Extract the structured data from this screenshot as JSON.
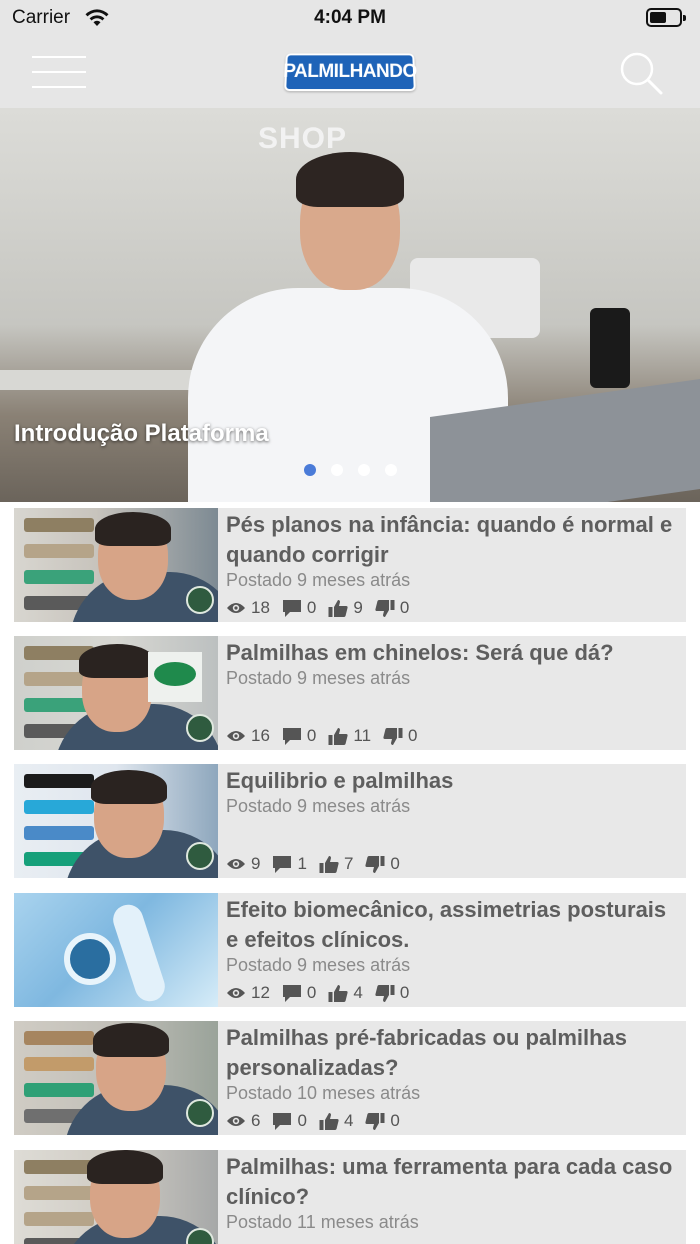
{
  "status_bar": {
    "carrier": "Carrier",
    "time": "4:04 PM",
    "battery_level": 0.55
  },
  "nav": {
    "logo_text": "PALMILHANDO",
    "menu_icon": "hamburger-icon",
    "search_icon": "search-icon"
  },
  "hero": {
    "wall_text": "SHOP",
    "title": "Introdução Plataforma",
    "slides": 4,
    "active_slide": 1
  },
  "videos": [
    {
      "title": "Pés planos na infância: quando é normal e quando corrigir",
      "posted": "Postado 9 meses atrás",
      "views": "18",
      "comments": "0",
      "likes": "9",
      "dislikes": "0"
    },
    {
      "title": "Palmilhas em chinelos: Será que dá?",
      "posted": "Postado 9 meses atrás",
      "views": "16",
      "comments": "0",
      "likes": "11",
      "dislikes": "0"
    },
    {
      "title": "Equilibrio e palmilhas",
      "posted": "Postado 9 meses atrás",
      "views": "9",
      "comments": "1",
      "likes": "7",
      "dislikes": "0"
    },
    {
      "title": "Efeito biomecânico, assimetrias posturais e efeitos clínicos.",
      "posted": "Postado 9 meses atrás",
      "views": "12",
      "comments": "0",
      "likes": "4",
      "dislikes": "0"
    },
    {
      "title": "Palmilhas pré-fabricadas ou palmilhas personalizadas?",
      "posted": "Postado 10 meses atrás",
      "views": "6",
      "comments": "0",
      "likes": "4",
      "dislikes": "0"
    },
    {
      "title": "Palmilhas: uma ferramenta para cada caso clínico?",
      "posted": "Postado 11 meses atrás",
      "views": "",
      "comments": "",
      "likes": "",
      "dislikes": ""
    }
  ],
  "colors": {
    "bar_bg": "#e6e6e6",
    "logo_blue": "#1e63b8",
    "dot_active": "#4a7bd8",
    "card_bg": "#e8e8e8"
  }
}
